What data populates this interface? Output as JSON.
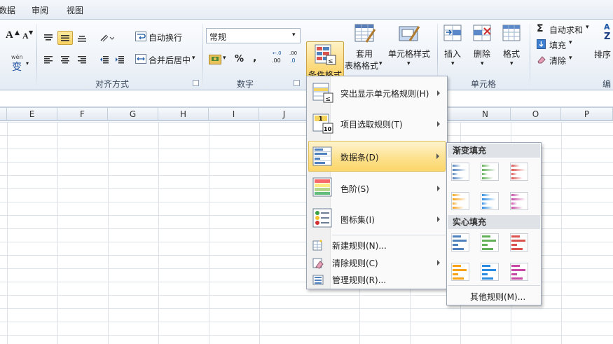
{
  "tabs": [
    "数据",
    "审阅",
    "视图"
  ],
  "font_group": {
    "grow_font": "A",
    "shrink_font": "A",
    "wen": "wén",
    "wen_char": "变"
  },
  "alignment": {
    "wrap_text": "自动换行",
    "merge_center": "合并后居中",
    "group_label": "对齐方式"
  },
  "number": {
    "format_value": "常规",
    "percent": "%",
    "comma": ",",
    "dec_inc": ".00",
    "dec_dec": ".0",
    "group_label": "数字"
  },
  "styles": {
    "cond_format": "条件格式",
    "table_format_1": "套用",
    "table_format_2": "表格格式",
    "cell_styles": "单元格样式"
  },
  "cells": {
    "insert": "插入",
    "delete": "删除",
    "format": "格式",
    "group_label": "单元格"
  },
  "editing": {
    "autosum": "自动求和",
    "fill": "填充",
    "clear": "清除",
    "sort": "排序",
    "group_label": "编"
  },
  "columns": [
    "E",
    "F",
    "G",
    "H",
    "I",
    "J",
    "N",
    "O",
    "P"
  ],
  "menu": {
    "highlight": "突出显示单元格规则(H)",
    "topbottom": "项目选取规则(T)",
    "databar": "数据条(D)",
    "colorscale": "色阶(S)",
    "iconset": "图标集(I)",
    "new_rule": "新建规则(N)...",
    "clear_rules": "清除规则(C)",
    "manage": "管理规则(R)..."
  },
  "submenu": {
    "gradient_header": "渐变填充",
    "solid_header": "实心填充",
    "more_rules": "其他规则(M)..."
  },
  "colors": {
    "blue": "#4f81bd",
    "green": "#63b05a",
    "red": "#d9534f",
    "orange": "#f7a21b",
    "lightblue": "#2b8be0",
    "purple": "#c74aa6"
  }
}
